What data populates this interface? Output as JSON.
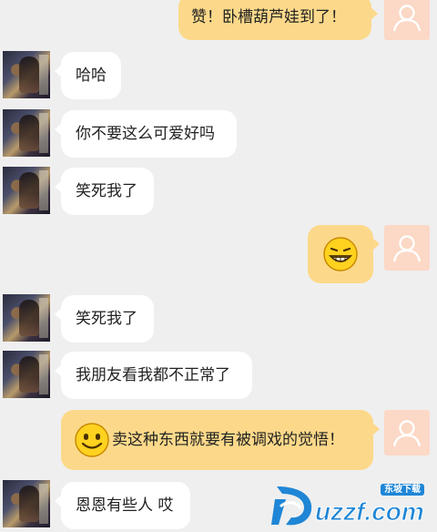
{
  "messages": [
    {
      "side": "right",
      "text": "赞！卧槽葫芦娃到了！"
    },
    {
      "side": "left",
      "text": "哈哈"
    },
    {
      "side": "left",
      "text": "你不要这么可爱好吗"
    },
    {
      "side": "left",
      "text": "笑死我了"
    },
    {
      "side": "right",
      "emoji": "grinning-face-emoji"
    },
    {
      "side": "left",
      "text": "笑死我了"
    },
    {
      "side": "left",
      "text": "我朋友看我都不正常了"
    },
    {
      "side": "right",
      "emoji": "smiling-face-emoji",
      "text": "卖这种东西就要有被调戏的觉悟！"
    },
    {
      "side": "left",
      "text": "恩恩有些人 哎"
    }
  ],
  "watermark": {
    "brand": "uzzf.com",
    "tag": "东坡下载",
    "logo_icon": "dongpo-logo-icon"
  },
  "colors": {
    "background": "#efefef",
    "bubble_self": "#fcd98a",
    "bubble_other": "#ffffff",
    "avatar_placeholder": "#fcd8c6",
    "watermark_blue": "#1f86d6"
  }
}
